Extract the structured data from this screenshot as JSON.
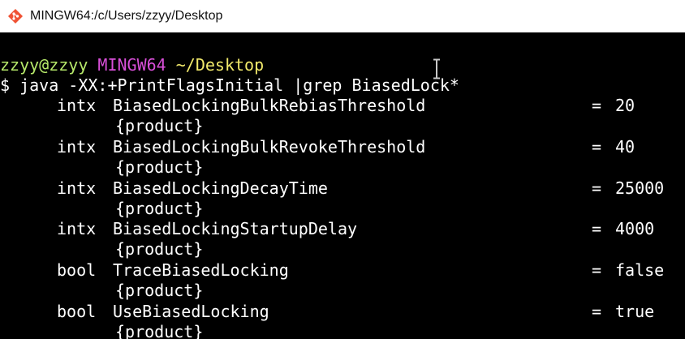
{
  "window": {
    "title": "MINGW64:/c/Users/zzyy/Desktop",
    "icon": "git-bash-icon"
  },
  "prompt": {
    "user_host": "zzyy@zzyy",
    "shell": "MINGW64",
    "path": "~/Desktop",
    "symbol": "$",
    "command": "java -XX:+PrintFlagsInitial |grep BiasedLock*"
  },
  "flags": [
    {
      "type": "intx",
      "name": "BiasedLockingBulkRebiasThreshold",
      "eq": "=",
      "value": "20",
      "kind": "{product}"
    },
    {
      "type": "intx",
      "name": "BiasedLockingBulkRevokeThreshold",
      "eq": "=",
      "value": "40",
      "kind": "{product}"
    },
    {
      "type": "intx",
      "name": "BiasedLockingDecayTime",
      "eq": "=",
      "value": "25000",
      "kind": "{product}"
    },
    {
      "type": "intx",
      "name": "BiasedLockingStartupDelay",
      "eq": "=",
      "value": "4000",
      "kind": "{product}"
    },
    {
      "type": "bool",
      "name": "TraceBiasedLocking",
      "eq": "=",
      "value": "false",
      "kind": "{product}"
    },
    {
      "type": "bool",
      "name": "UseBiasedLocking",
      "eq": "=",
      "value": "true",
      "kind": "{product}"
    }
  ],
  "colors": {
    "user_host": "#b6e86a",
    "shell": "#d84fd8",
    "path": "#f2ea6b",
    "text": "#ffffff",
    "background": "#000000"
  },
  "mouse_cursor": "i-beam-cursor"
}
